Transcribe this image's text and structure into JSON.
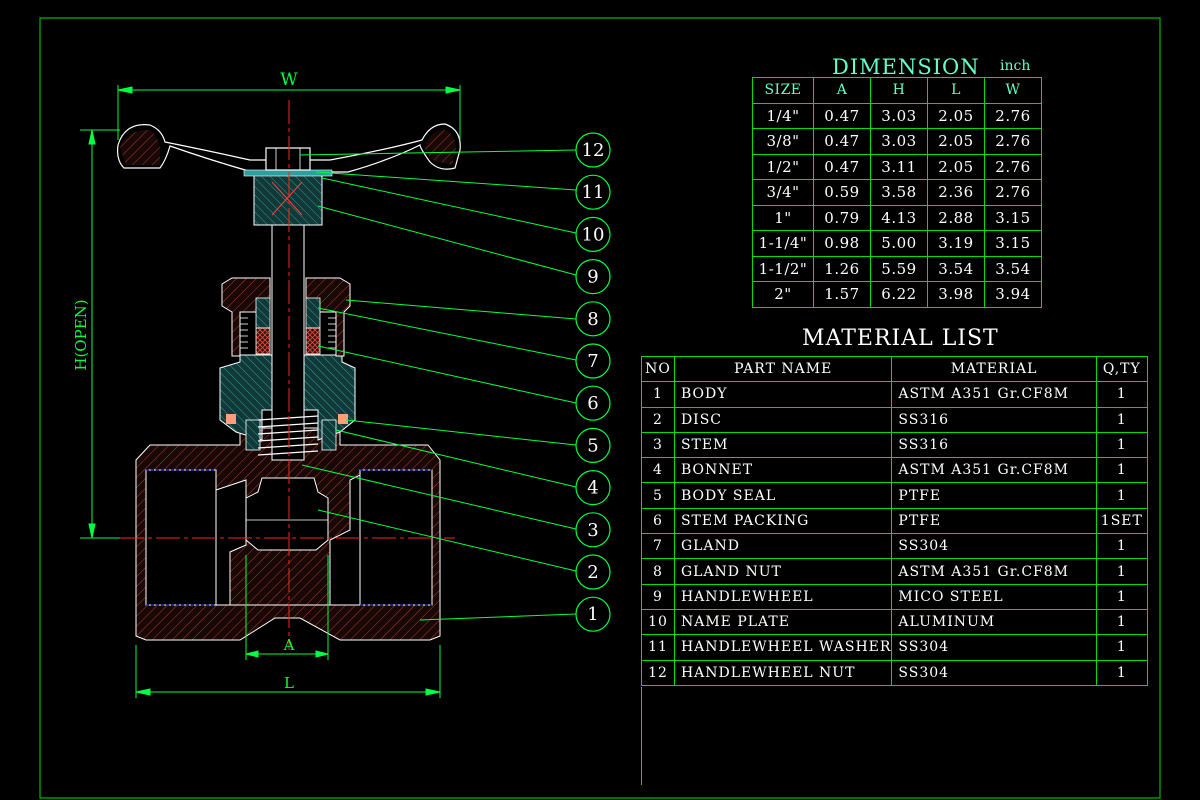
{
  "drawing": {
    "dimension_labels": {
      "w": "W",
      "h_open": "H(OPEN)",
      "a": "A",
      "l": "L"
    },
    "callouts": [
      "12",
      "11",
      "10",
      "9",
      "8",
      "7",
      "6",
      "5",
      "4",
      "3",
      "2",
      "1"
    ]
  },
  "dimension_table": {
    "title": "DIMENSION",
    "unit": "inch",
    "headers": [
      "SIZE",
      "A",
      "H",
      "L",
      "W"
    ],
    "rows": [
      [
        "1/4\"",
        "0.47",
        "3.03",
        "2.05",
        "2.76"
      ],
      [
        "3/8\"",
        "0.47",
        "3.03",
        "2.05",
        "2.76"
      ],
      [
        "1/2\"",
        "0.47",
        "3.11",
        "2.05",
        "2.76"
      ],
      [
        "3/4\"",
        "0.59",
        "3.58",
        "2.36",
        "2.76"
      ],
      [
        "1\"",
        "0.79",
        "4.13",
        "2.88",
        "3.15"
      ],
      [
        "1-1/4\"",
        "0.98",
        "5.00",
        "3.19",
        "3.15"
      ],
      [
        "1-1/2\"",
        "1.26",
        "5.59",
        "3.54",
        "3.54"
      ],
      [
        "2\"",
        "1.57",
        "6.22",
        "3.98",
        "3.94"
      ]
    ]
  },
  "material_list": {
    "title": "MATERIAL LIST",
    "headers": [
      "NO",
      "PART NAME",
      "MATERIAL",
      "Q,TY"
    ],
    "rows": [
      [
        "1",
        "BODY",
        "ASTM A351 Gr.CF8M",
        "1"
      ],
      [
        "2",
        "DISC",
        "SS316",
        "1"
      ],
      [
        "3",
        "STEM",
        "SS316",
        "1"
      ],
      [
        "4",
        "BONNET",
        "ASTM A351 Gr.CF8M",
        "1"
      ],
      [
        "5",
        "BODY SEAL",
        "PTFE",
        "1"
      ],
      [
        "6",
        "STEM PACKING",
        "PTFE",
        "1SET"
      ],
      [
        "7",
        "GLAND",
        "SS304",
        "1"
      ],
      [
        "8",
        "GLAND NUT",
        "ASTM A351 Gr.CF8M",
        "1"
      ],
      [
        "9",
        "HANDLEWHEEL",
        "MICO STEEL",
        "1"
      ],
      [
        "10",
        "NAME PLATE",
        "ALUMINUM",
        "1"
      ],
      [
        "11",
        "HANDLEWHEEL WASHER",
        "SS304",
        "1"
      ],
      [
        "12",
        "HANDLEWHEEL NUT",
        "SS304",
        "1"
      ]
    ]
  },
  "colors": {
    "frame": "#00e000",
    "centerline": "#ff2020",
    "hatch": "#c04020",
    "section_fill": "#1a4a4a",
    "thread": "#ffffff"
  }
}
